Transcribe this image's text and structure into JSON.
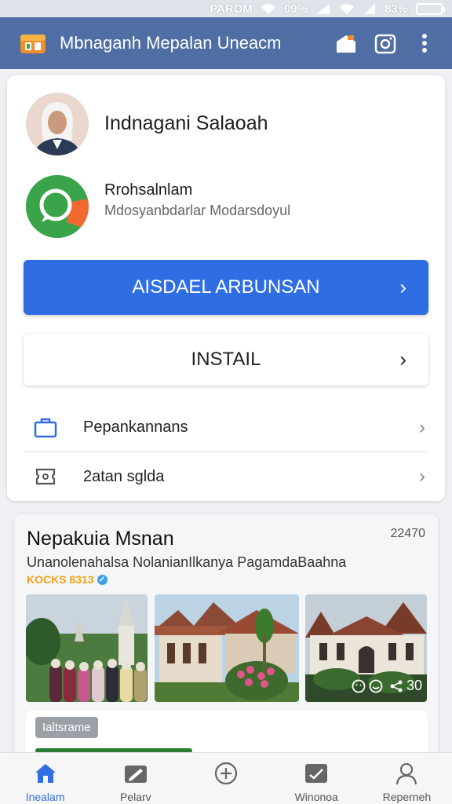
{
  "status_bar": {
    "carrier": "PAROM",
    "net": "09%",
    "battery": "83%"
  },
  "app_bar": {
    "title": "Mbnaganh Mepalan Uneacm"
  },
  "profile": {
    "name": "Indnagani Salaoah",
    "sub_title": "Rrohsalnlam",
    "sub_desc": "Mdosyanbdarlar Modarsdoyul"
  },
  "buttons": {
    "primary": "AISDAEL ARBUNSAN",
    "secondary": "INSTAIL"
  },
  "menu": [
    {
      "label": "Pepankannans",
      "icon": "briefcase-icon"
    },
    {
      "label": "2atan sglda",
      "icon": "ticket-icon"
    }
  ],
  "post": {
    "title": "Nepakuia Msnan",
    "count": "22470",
    "description": "Unanolenahalsa NolanianIlkanya PagamdaBaahna",
    "meta": "KOCKS 8313",
    "thumb_overlay_count": "30",
    "sub_tag": "Ialtsrame"
  },
  "bottom_nav": [
    {
      "label": "Inealam",
      "icon": "home-icon",
      "active": true
    },
    {
      "label": "Pelarv",
      "icon": "edit-icon",
      "active": false
    },
    {
      "label": "",
      "icon": "add-circle-icon",
      "active": false
    },
    {
      "label": "Winonoa",
      "icon": "inbox-icon",
      "active": false
    },
    {
      "label": "Reperneh",
      "icon": "profile-icon",
      "active": false
    }
  ],
  "colors": {
    "app_bar": "#4e6ea4",
    "primary_button": "#2f6ee2",
    "accent_meta": "#f0a21a",
    "whatsapp_green": "#3aa44a"
  }
}
